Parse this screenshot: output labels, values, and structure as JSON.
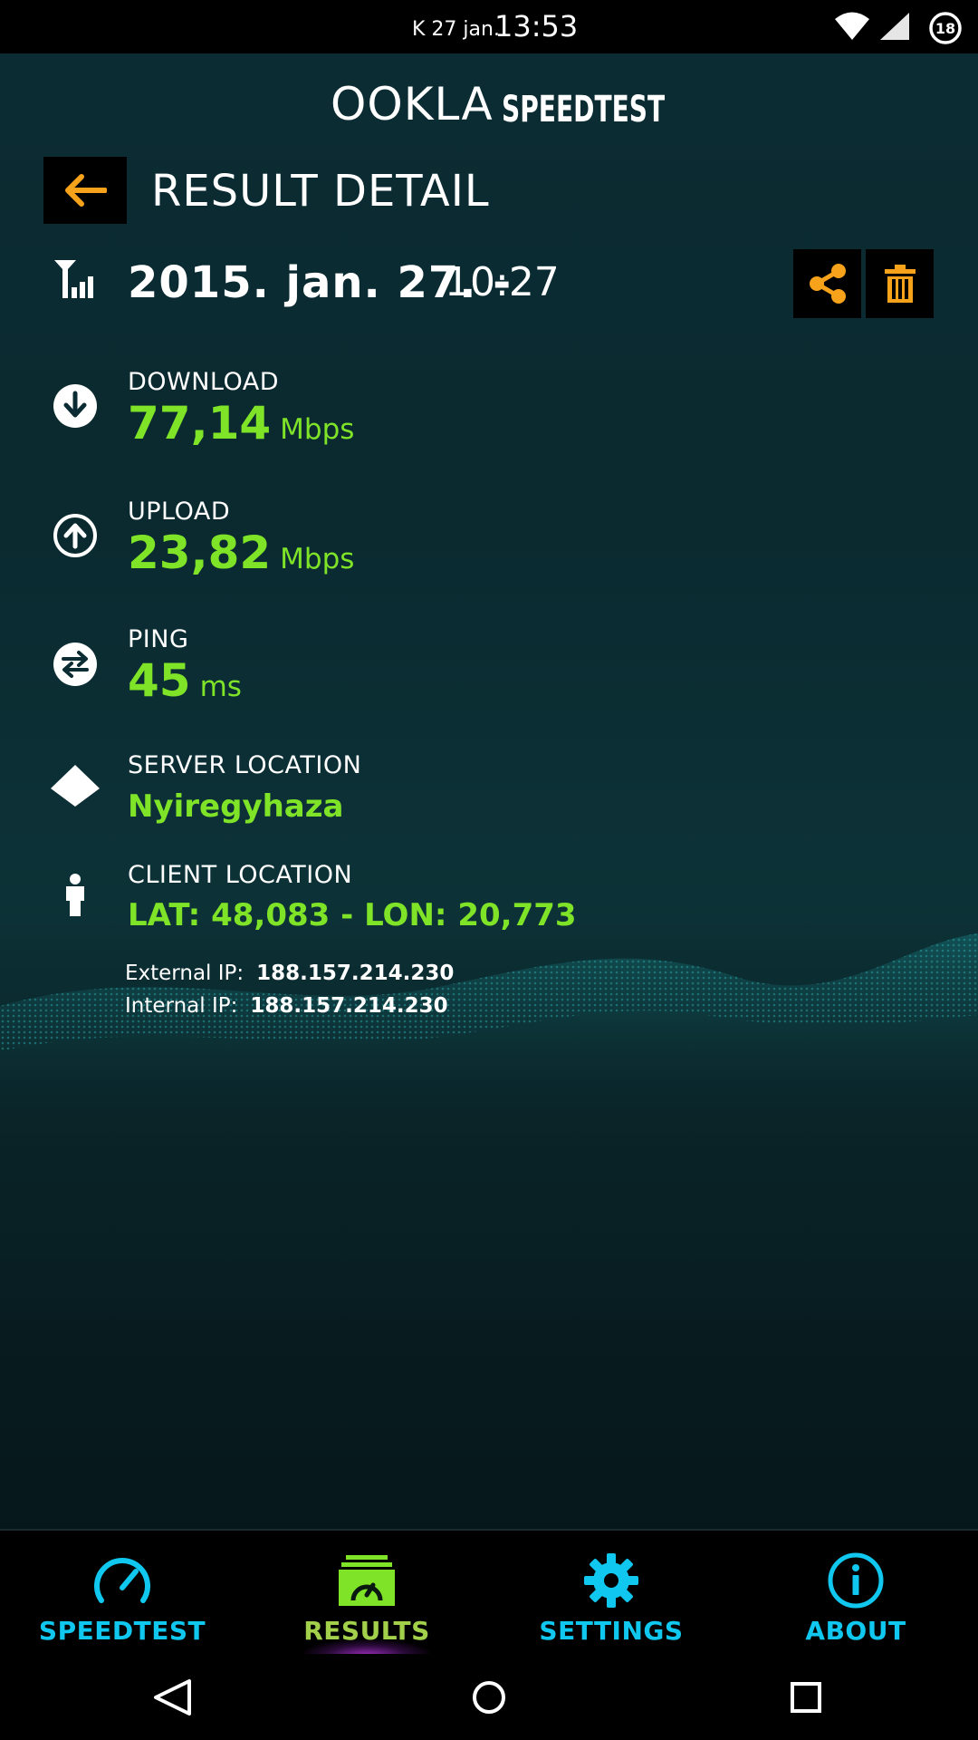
{
  "status_bar": {
    "date": "K 27 jan.",
    "time": "13:53",
    "battery_level": "18",
    "icons": [
      "wifi-icon",
      "cell-signal-icon",
      "battery-icon"
    ]
  },
  "header": {
    "brand_ookla": "OOKLA",
    "brand_speedtest": "SPEEDTEST",
    "title": "RESULT DETAIL"
  },
  "result": {
    "date": "2015. jan. 27. -",
    "time": "10:27",
    "download": {
      "label": "DOWNLOAD",
      "value": "77,14",
      "unit": "Mbps"
    },
    "upload": {
      "label": "UPLOAD",
      "value": "23,82",
      "unit": "Mbps"
    },
    "ping": {
      "label": "PING",
      "value": "45",
      "unit": "ms"
    },
    "server": {
      "label": "SERVER LOCATION",
      "value": "Nyiregyhaza"
    },
    "client": {
      "label": "CLIENT LOCATION",
      "value": "LAT: 48,083 - LON: 20,773"
    },
    "external_ip": {
      "label": "External IP:",
      "value": "188.157.214.230"
    },
    "internal_ip": {
      "label": "Internal IP:",
      "value": "188.157.214.230"
    }
  },
  "tabs": [
    {
      "label": "SPEEDTEST",
      "icon": "speedometer-icon",
      "active": false
    },
    {
      "label": "RESULTS",
      "icon": "results-icon",
      "active": true
    },
    {
      "label": "SETTINGS",
      "icon": "gear-icon",
      "active": false
    },
    {
      "label": "ABOUT",
      "icon": "info-icon",
      "active": false
    }
  ],
  "colors": {
    "accent_green": "#7fe328",
    "accent_orange": "#f7a21b",
    "tab_blue": "#10c8ef",
    "tab_active": "#a3d04a"
  }
}
